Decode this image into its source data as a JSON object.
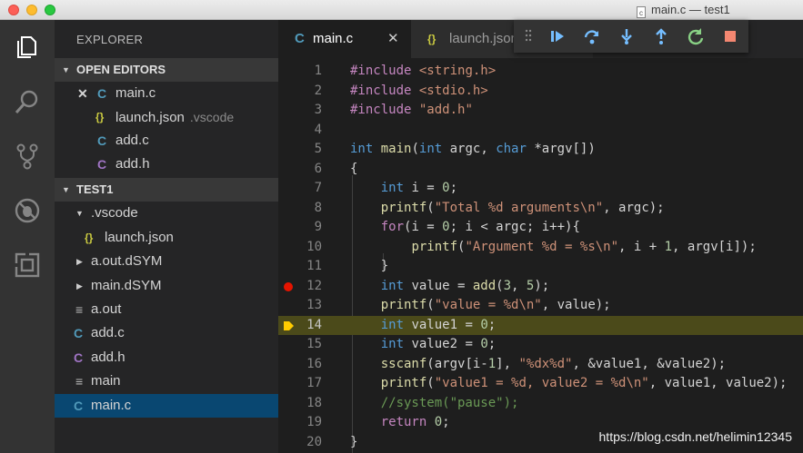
{
  "window": {
    "title": "main.c — test1"
  },
  "activity_bar": {
    "items": [
      "explorer-icon",
      "search-icon",
      "source-control-icon",
      "debug-icon",
      "extensions-icon"
    ]
  },
  "sidebar": {
    "title": "EXPLORER",
    "open_editors": {
      "header": "OPEN EDITORS",
      "items": [
        {
          "icon": "C",
          "label": "main.c",
          "desc": "",
          "close": "✕"
        },
        {
          "icon": "{}",
          "label": "launch.json",
          "desc": ".vscode"
        },
        {
          "icon": "C",
          "label": "add.c",
          "desc": ""
        },
        {
          "icon": "C",
          "label": "add.h",
          "desc": ""
        }
      ]
    },
    "project": {
      "header": "TEST1",
      "items": [
        {
          "icon": "",
          "label": ".vscode"
        },
        {
          "icon": "{}",
          "label": "launch.json"
        },
        {
          "icon": "",
          "label": "a.out.dSYM"
        },
        {
          "icon": "",
          "label": "main.dSYM"
        },
        {
          "icon": "≡",
          "label": "a.out"
        },
        {
          "icon": "C",
          "label": "add.c"
        },
        {
          "icon": "C",
          "label": "add.h"
        },
        {
          "icon": "≡",
          "label": "main"
        },
        {
          "icon": "C",
          "label": "main.c"
        }
      ]
    }
  },
  "tabs": [
    {
      "icon": "C",
      "label": "main.c",
      "close": "✕"
    },
    {
      "icon": "{}",
      "label": "launch.json"
    }
  ],
  "debug_toolbar": {
    "buttons": [
      "continue-icon",
      "step-over-icon",
      "step-into-icon",
      "step-out-icon",
      "restart-icon",
      "stop-icon"
    ]
  },
  "editor": {
    "breakpoint_line": 12,
    "current_line": 14,
    "line_numbers": [
      "1",
      "2",
      "3",
      "4",
      "5",
      "6",
      "7",
      "8",
      "9",
      "10",
      "11",
      "12",
      "13",
      "14",
      "15",
      "16",
      "17",
      "18",
      "19",
      "20"
    ],
    "lines": [
      "#include <string.h>",
      "#include <stdio.h>",
      "#include \"add.h\"",
      "",
      "int main(int argc, char *argv[])",
      "{",
      "    int i = 0;",
      "    printf(\"Total %d arguments\\n\", argc);",
      "    for(i = 0; i < argc; i++){",
      "        printf(\"Argument %d = %s\\n\", i + 1, argv[i]);",
      "    }",
      "    int value = add(3, 5);",
      "    printf(\"value = %d\\n\", value);",
      "    int value1 = 0;",
      "    int value2 = 0;",
      "    sscanf(argv[i-1], \"%dx%d\", &value1, &value2);",
      "    printf(\"value1 = %d, value2 = %d\\n\", value1, value2);",
      "    //system(\"pause\");",
      "    return 0;",
      "}"
    ]
  },
  "watermark": "https://blog.csdn.net/helimin12345"
}
